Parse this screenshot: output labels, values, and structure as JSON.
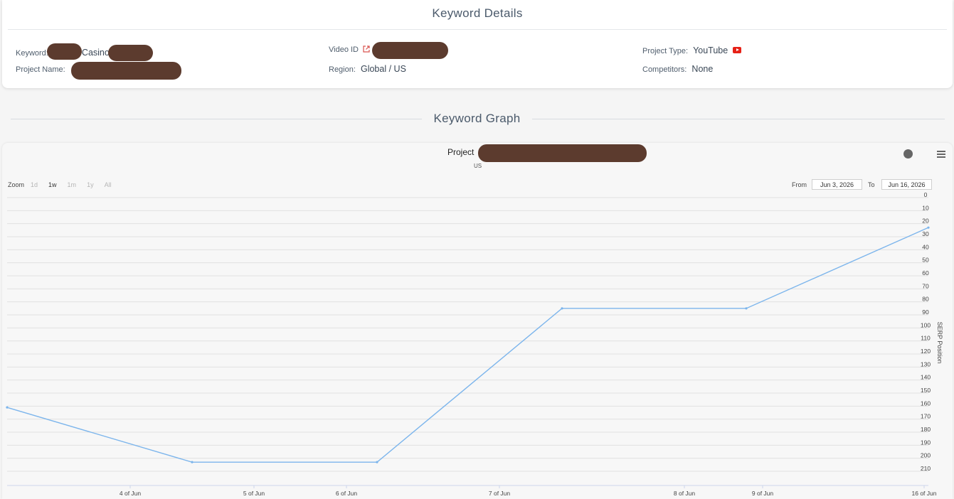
{
  "details": {
    "title": "Keyword Details",
    "keyword_label": "Keyword:",
    "keyword_value": "Casino",
    "project_name_label": "Project Name:",
    "video_id_label": "Video ID",
    "region_label": "Region:",
    "region_value": "Global / US",
    "project_type_label": "Project Type:",
    "project_type_value": "YouTube",
    "competitors_label": "Competitors:",
    "competitors_value": "None"
  },
  "graph_section": {
    "title": "Keyword Graph"
  },
  "chart_controls": {
    "zoom_label": "Zoom",
    "zoom_options": [
      "1d",
      "1w",
      "1m",
      "1y",
      "All"
    ],
    "zoom_active": "1w",
    "from_label": "From",
    "from_value": "Jun 3, 2026",
    "to_label": "To",
    "to_value": "Jun 16, 2026"
  },
  "chart_data": {
    "type": "line",
    "title": "Project",
    "subtitle": "US",
    "ylabel": "SERP Position",
    "y_reversed": true,
    "ylim": [
      0,
      215
    ],
    "y_ticks": [
      0,
      10,
      20,
      30,
      40,
      50,
      60,
      70,
      80,
      90,
      100,
      110,
      120,
      130,
      140,
      150,
      160,
      170,
      180,
      190,
      200,
      210
    ],
    "x_ticks": [
      "4 of Jun",
      "5 of Jun",
      "6 of Jun",
      "7 of Jun",
      "8 of Jun",
      "9 of Jun",
      "16 of Jun"
    ],
    "series": [
      {
        "color": "#7cb5ec",
        "points": [
          {
            "x": "Jun 3, 2026",
            "y": 161
          },
          {
            "x": "Jun 4, 2026",
            "y": 203
          },
          {
            "x": "Jun 5, 2026",
            "y": 203
          },
          {
            "x": "Jun 7, 2026",
            "y": 85
          },
          {
            "x": "Jun 8, 2026",
            "y": 85
          },
          {
            "x": "Jun 16, 2026",
            "y": 23
          }
        ]
      }
    ],
    "grid": true
  }
}
